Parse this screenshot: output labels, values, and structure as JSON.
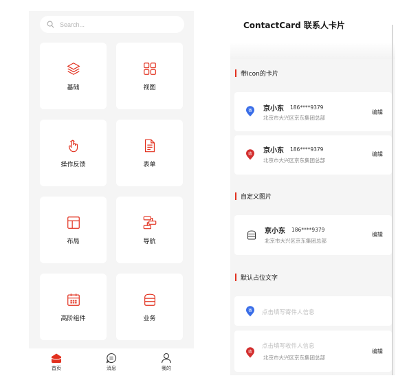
{
  "left": {
    "search": {
      "placeholder": "Search..."
    },
    "tiles": [
      {
        "label": "基础",
        "icon": "layers-icon"
      },
      {
        "label": "视图",
        "icon": "grid-icon"
      },
      {
        "label": "操作反馈",
        "icon": "hand-pointer-icon"
      },
      {
        "label": "表单",
        "icon": "document-icon"
      },
      {
        "label": "布局",
        "icon": "layout-icon"
      },
      {
        "label": "导航",
        "icon": "navigation-icon"
      },
      {
        "label": "高阶组件",
        "icon": "calendar-icon"
      },
      {
        "label": "业务",
        "icon": "box-icon"
      }
    ],
    "tabbar": [
      {
        "label": "首页",
        "icon": "home-icon",
        "active": true
      },
      {
        "label": "消息",
        "icon": "message-icon",
        "active": false
      },
      {
        "label": "我的",
        "icon": "user-icon",
        "active": false
      }
    ]
  },
  "right": {
    "title": "ContactCard 联系人卡片",
    "sections": [
      {
        "title": "带Icon的卡片"
      },
      {
        "title": "自定义图片"
      },
      {
        "title": "默认占位文字"
      }
    ],
    "cards": [
      {
        "pin_label": "寄",
        "name": "京小东",
        "phone": "186****9379",
        "address": "北京市大兴区京东集团总部",
        "edit": "编辑"
      },
      {
        "pin_label": "收",
        "name": "京小东",
        "phone": "186****9379",
        "address": "北京市大兴区京东集团总部",
        "edit": "编辑"
      },
      {
        "name": "京小东",
        "phone": "186****9379",
        "address": "北京市大兴区京东集团总部",
        "edit": "编辑"
      }
    ],
    "placeholder_cards": [
      {
        "pin_label": "寄",
        "placeholder": "点击填写寄件人信息"
      },
      {
        "pin_label": "收",
        "placeholder": "点击填写收件人信息",
        "address": "北京市大兴区京东集团总部",
        "edit": "编辑"
      }
    ]
  },
  "colors": {
    "accent": "#e2301e",
    "sender_pin": "#3a6ee8",
    "receiver_pin": "#d32f2f",
    "background": "#f5f5f5"
  }
}
